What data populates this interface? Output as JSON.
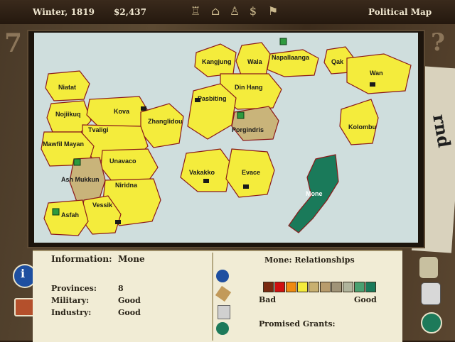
{
  "topbar": {
    "date": "Winter, 1819",
    "treasury": "$2,437",
    "screen_title": "Political Map",
    "icons": [
      "advisor-icon",
      "capitol-icon",
      "boot-icon",
      "dollar-icon",
      "factory-icon"
    ]
  },
  "colors": {
    "ocean": "#cfdedd",
    "player_yellow": "#f4ec3c",
    "neutral_tan": "#c9b47a",
    "mone_green": "#1a7a5a",
    "border_red": "#8b1a1a"
  },
  "map": {
    "provinces": [
      {
        "name": "Kangjung"
      },
      {
        "name": "Wala"
      },
      {
        "name": "Napallaanga"
      },
      {
        "name": "Qak"
      },
      {
        "name": "Wan"
      },
      {
        "name": "Niatat"
      },
      {
        "name": "Nojiikuq"
      },
      {
        "name": "Kova"
      },
      {
        "name": "Pasbiting"
      },
      {
        "name": "Din Hang"
      },
      {
        "name": "Tvaligi"
      },
      {
        "name": "Zhanglidou"
      },
      {
        "name": "Porgindris"
      },
      {
        "name": "Kolombu"
      },
      {
        "name": "Mawfil Mayan"
      },
      {
        "name": "Unavaco"
      },
      {
        "name": "Ash Mukkun"
      },
      {
        "name": "Niridna"
      },
      {
        "name": "Vakakko"
      },
      {
        "name": "Evace"
      },
      {
        "name": "Mone"
      },
      {
        "name": "Vessik"
      },
      {
        "name": "Asfah"
      }
    ]
  },
  "info": {
    "header_label": "Information:",
    "header_value": "Mone",
    "rows": [
      {
        "label": "Provinces:",
        "value": "8"
      },
      {
        "label": "Military:",
        "value": "Good"
      },
      {
        "label": "Industry:",
        "value": "Good"
      }
    ]
  },
  "relationships": {
    "title": "Mone: Relationships",
    "bad_label": "Bad",
    "good_label": "Good",
    "scale_colors": [
      "#7a2a10",
      "#d01010",
      "#f08a10",
      "#f4ec3c",
      "#c8b070",
      "#b89c6c",
      "#a09478",
      "#b0b49c",
      "#4aa070",
      "#1a7a5a"
    ],
    "grants_label": "Promised Grants:"
  },
  "side_icons": {
    "left": [
      "info-icon",
      "briefcase-icon"
    ],
    "middle": [
      "info-icon",
      "scroll-icon",
      "document-icon",
      "pyramid-icon"
    ],
    "right": [
      "scroll-icon",
      "report-icon",
      "pyramid-icon"
    ]
  }
}
